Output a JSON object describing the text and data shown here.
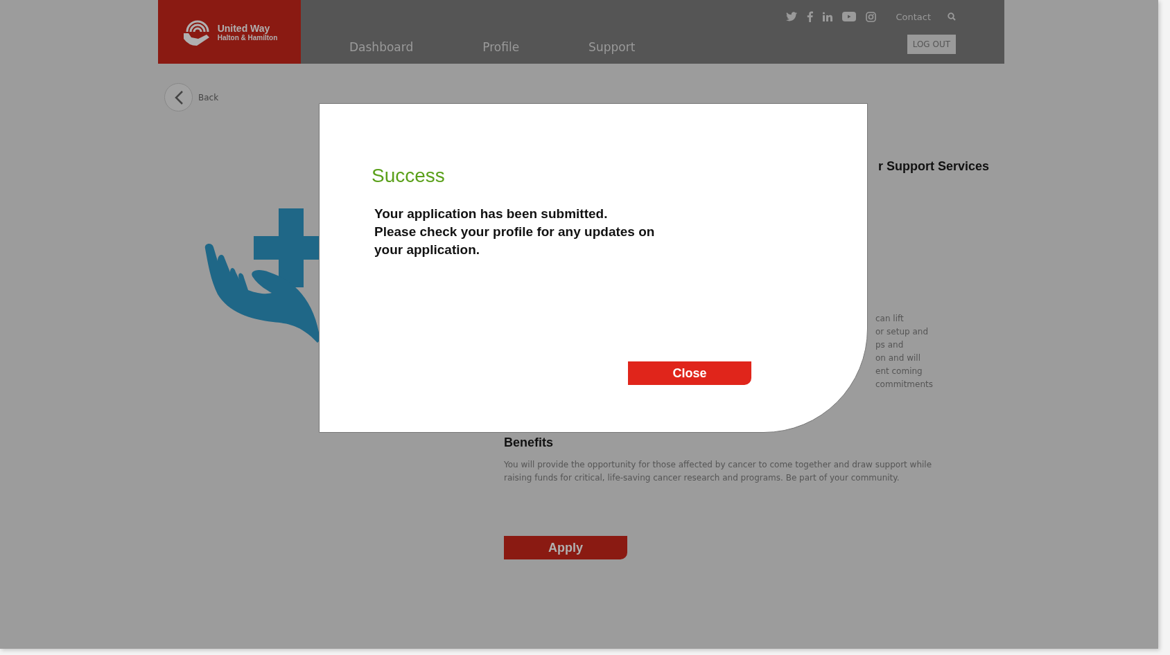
{
  "header": {
    "logo": {
      "name": "United Way",
      "subtitle": "Halton & Hamilton"
    },
    "nav": [
      {
        "label": "Dashboard"
      },
      {
        "label": "Profile"
      },
      {
        "label": "Support"
      }
    ],
    "contact": "Contact",
    "logout": "LOG OUT"
  },
  "back": "Back",
  "page": {
    "title_fragment": "r Support Services",
    "description_fragments": [
      "can lift",
      "or setup and",
      "ps and",
      "on and will",
      "ent coming",
      "commitments"
    ],
    "benefits": {
      "heading": "Benefits",
      "text": "You will provide the opportunity for those affected by cancer to come together and draw support while raising funds for critical, life-saving cancer research and programs. Be part of your community."
    },
    "apply": "Apply"
  },
  "modal": {
    "title": "Success",
    "message": [
      "Your application has been submitted.",
      "Please check your profile for any updates on your application."
    ],
    "close": "Close"
  }
}
